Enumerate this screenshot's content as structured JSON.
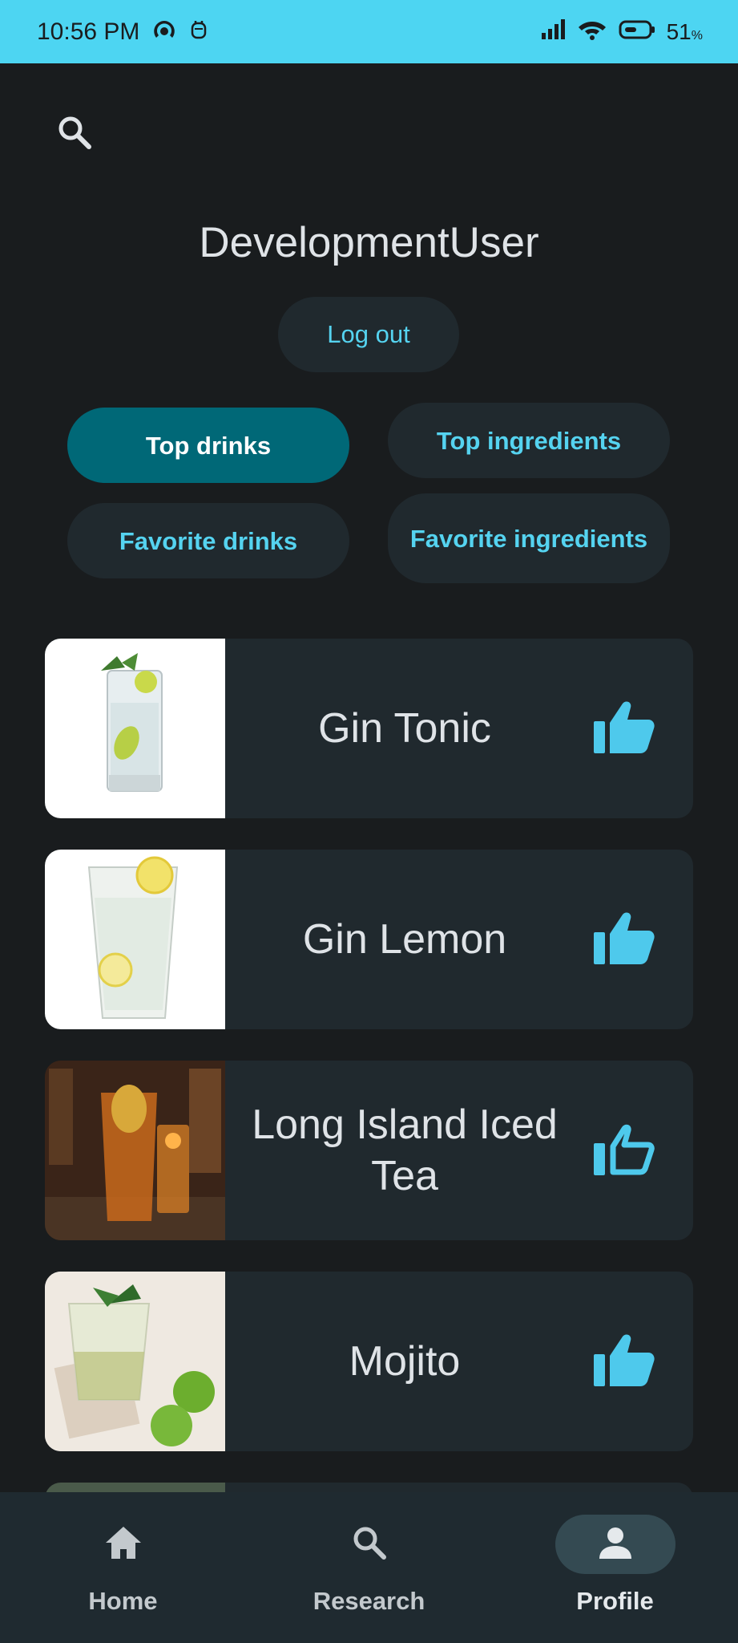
{
  "status_bar": {
    "time": "10:56 PM",
    "battery_value": "51",
    "battery_unit": "%"
  },
  "profile": {
    "username": "DevelopmentUser",
    "logout_label": "Log out"
  },
  "filters": [
    {
      "label": "Top drinks",
      "active": true
    },
    {
      "label": "Top ingredients",
      "active": false
    },
    {
      "label": "Favorite drinks",
      "active": false
    },
    {
      "label": "Favorite ingredients",
      "active": false
    }
  ],
  "drinks": [
    {
      "name": "Gin Tonic",
      "liked": true,
      "image": "gin-tonic-image"
    },
    {
      "name": "Gin Lemon",
      "liked": true,
      "image": "gin-lemon-image"
    },
    {
      "name": "Long Island Iced Tea",
      "liked": false,
      "image": "long-island-image"
    },
    {
      "name": "Mojito",
      "liked": true,
      "image": "mojito-image"
    }
  ],
  "bottom_nav": [
    {
      "label": "Home",
      "icon": "home-icon",
      "active": false
    },
    {
      "label": "Research",
      "icon": "search-icon",
      "active": false
    },
    {
      "label": "Profile",
      "icon": "person-icon",
      "active": true
    }
  ],
  "colors": {
    "status_bar": "#4dd5f2",
    "background": "#191c1e",
    "card": "#20292e",
    "accent": "#55d3f0",
    "active_chip": "#006877"
  }
}
